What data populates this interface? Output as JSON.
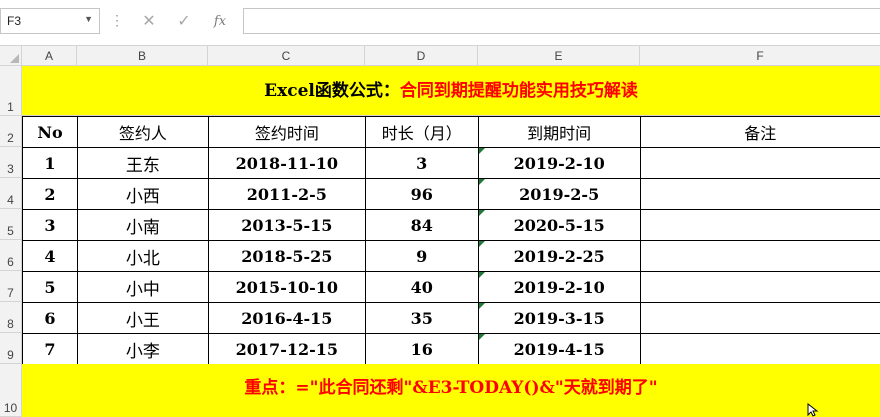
{
  "formula_bar": {
    "name_box": "F3",
    "dropdown_icon": "chevron-down-icon",
    "dots": "⋮",
    "cancel_glyph": "✕",
    "enter_glyph": "✓",
    "fx_glyph": "fx",
    "formula": ""
  },
  "columns": [
    "A",
    "B",
    "C",
    "D",
    "E",
    "F"
  ],
  "rows": [
    "1",
    "2",
    "3",
    "4",
    "5",
    "6",
    "7",
    "8",
    "9",
    "10"
  ],
  "title": {
    "part1": "Excel函数公式：",
    "part2": "合同到期提醒功能实用技巧解读"
  },
  "table": {
    "headers": [
      "No",
      "签约人",
      "签约时间",
      "时长（月）",
      "到期时间",
      "备注"
    ],
    "rows": [
      [
        "1",
        "王东",
        "2018-11-10",
        "3",
        "2019-2-10",
        ""
      ],
      [
        "2",
        "小西",
        "2011-2-5",
        "96",
        "2019-2-5",
        ""
      ],
      [
        "3",
        "小南",
        "2013-5-15",
        "84",
        "2020-5-15",
        ""
      ],
      [
        "4",
        "小北",
        "2018-5-25",
        "9",
        "2019-2-25",
        ""
      ],
      [
        "5",
        "小中",
        "2015-10-10",
        "40",
        "2019-2-10",
        ""
      ],
      [
        "6",
        "小王",
        "2016-4-15",
        "35",
        "2019-3-15",
        ""
      ],
      [
        "7",
        "小李",
        "2017-12-15",
        "16",
        "2019-4-15",
        ""
      ]
    ]
  },
  "note": {
    "label": "重点：",
    "formula": "=\"此合同还剩\"&E3-TODAY()&\"天就到期了\""
  },
  "colors": {
    "banner_bg": "#ffff00",
    "accent_red": "#ff0000",
    "header_bg": "#f2f2f2"
  }
}
